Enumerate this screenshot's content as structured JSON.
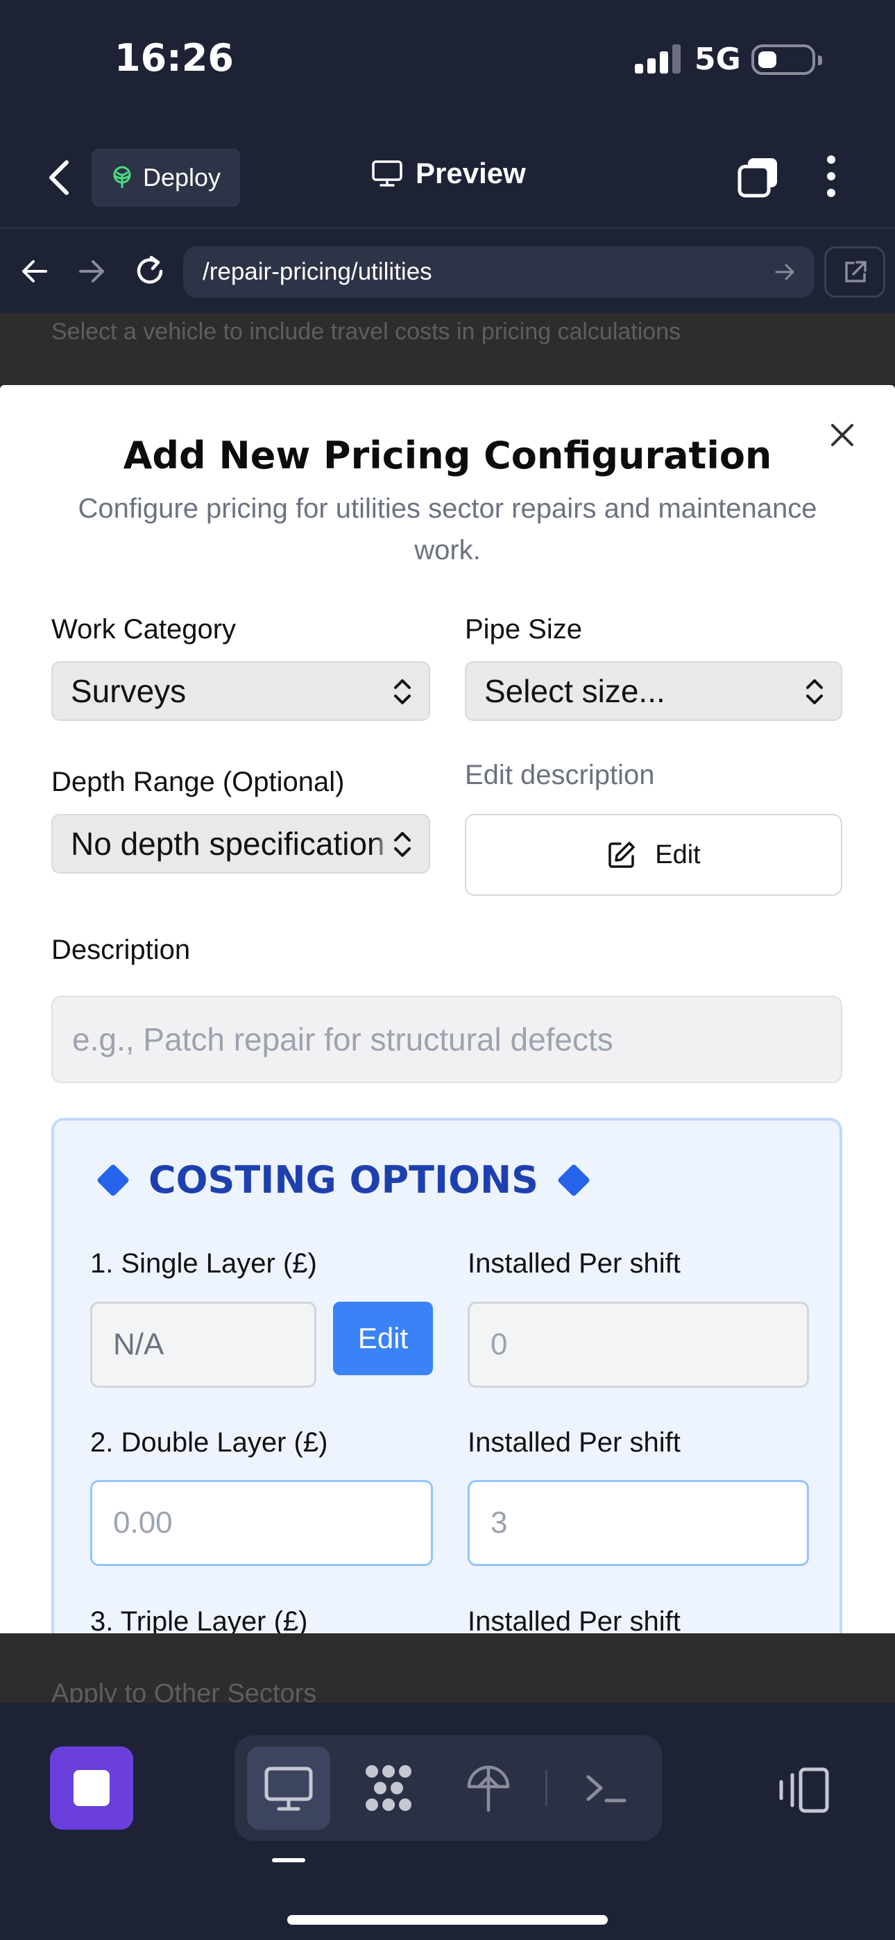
{
  "status_bar": {
    "time": "16:26",
    "network": "5G"
  },
  "header": {
    "deploy_label": "Deploy",
    "preview_label": "Preview"
  },
  "url_bar": {
    "url": "/repair-pricing/utilities"
  },
  "background_page": {
    "vehicle_hint": "Select a vehicle to include travel costs in pricing calculations",
    "apply_sectors": "Apply to Other Sectors"
  },
  "modal": {
    "title": "Add New Pricing Configuration",
    "subtitle": "Configure pricing for utilities sector repairs and maintenance work.",
    "work_category": {
      "label": "Work Category",
      "value": "Surveys"
    },
    "pipe_size": {
      "label": "Pipe Size",
      "value": "Select size..."
    },
    "depth_range": {
      "label": "Depth Range (Optional)",
      "value": "No depth specification"
    },
    "edit_description": {
      "label": "Edit description",
      "button": "Edit"
    },
    "description": {
      "label": "Description",
      "placeholder": "e.g., Patch repair for structural defects"
    },
    "costing": {
      "heading": "COSTING OPTIONS",
      "options": [
        {
          "label": "1. Single Layer (£)",
          "value": "N/A",
          "edit_button": "Edit",
          "per_shift_label": "Installed Per shift",
          "per_shift_placeholder": "0"
        },
        {
          "label": "2. Double Layer (£)",
          "placeholder": "0.00",
          "per_shift_label": "Installed Per shift",
          "per_shift_placeholder": "3"
        },
        {
          "label": "3. Triple Layer (£)",
          "per_shift_label": "Installed Per shift"
        }
      ]
    }
  },
  "colors": {
    "accent": "#3b82f6",
    "costing_bg": "#eef4fe",
    "costing_title": "#1e40af",
    "stop_button": "#6a3fdc"
  }
}
